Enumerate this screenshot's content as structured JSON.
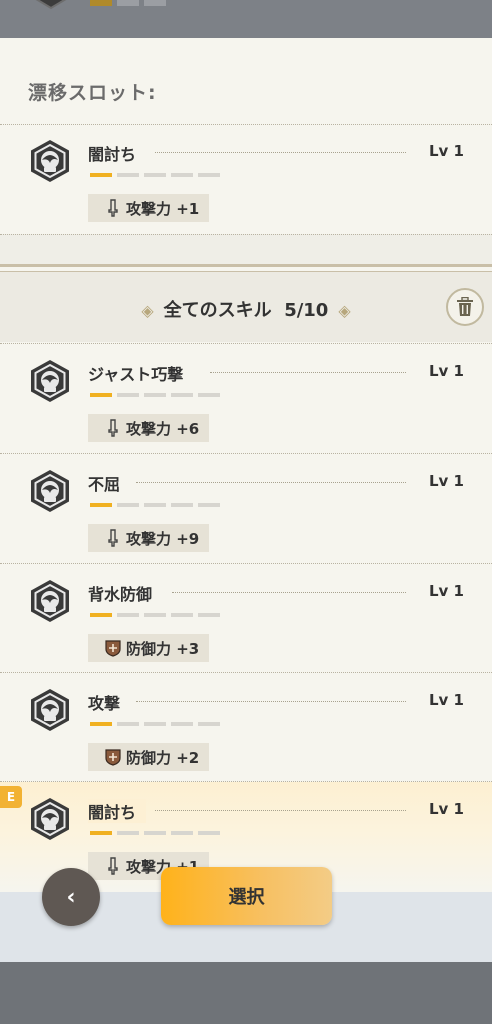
{
  "slot": {
    "title": "漂移スロット:",
    "skill": {
      "name": "闇討ち",
      "level": "Lv 1",
      "level_filled": 1,
      "level_total": 5,
      "stat": "攻撃力 +1",
      "stat_icon": "sword-icon"
    }
  },
  "skills_header": {
    "label": "全てのスキル",
    "count": "5/10",
    "trash_icon": "trash-icon"
  },
  "skills": [
    {
      "name": "ジャスト巧撃",
      "level": "Lv 1",
      "level_filled": 1,
      "level_total": 5,
      "stat": "攻撃力 +6",
      "stat_icon": "sword-icon",
      "equipped": false
    },
    {
      "name": "不屈",
      "level": "Lv 1",
      "level_filled": 1,
      "level_total": 5,
      "stat": "攻撃力 +9",
      "stat_icon": "sword-icon",
      "equipped": false
    },
    {
      "name": "背水防御",
      "level": "Lv 1",
      "level_filled": 1,
      "level_total": 5,
      "stat": "防御力 +3",
      "stat_icon": "shield-icon",
      "equipped": false
    },
    {
      "name": "攻撃",
      "level": "Lv 1",
      "level_filled": 1,
      "level_total": 5,
      "stat": "防御力 +2",
      "stat_icon": "shield-icon",
      "equipped": false
    },
    {
      "name": "闇討ち",
      "level": "Lv 1",
      "level_filled": 1,
      "level_total": 5,
      "stat": "攻撃力 +1",
      "stat_icon": "sword-icon",
      "equipped": true,
      "badge": "E"
    }
  ],
  "buttons": {
    "back_icon": "‹",
    "select_label": "選択"
  },
  "colors": {
    "accent": "#f0b020",
    "badge": "#f2b233",
    "select_button": "#ffb21a"
  }
}
